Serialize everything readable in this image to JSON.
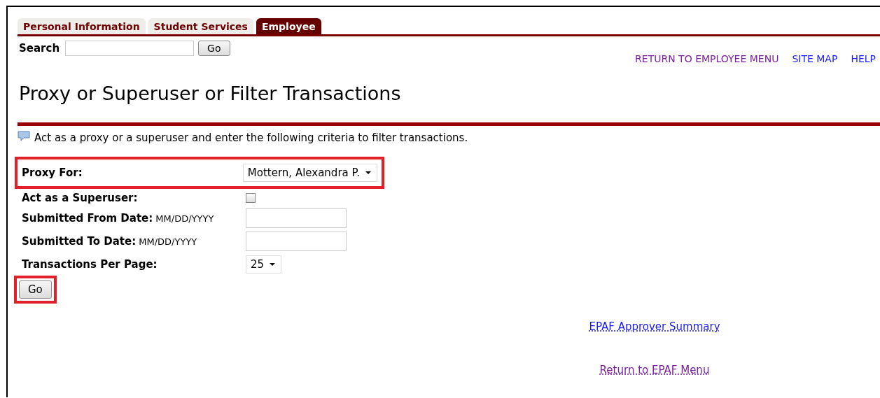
{
  "tabs": [
    {
      "label": "Personal Information",
      "selected": false
    },
    {
      "label": "Student Services",
      "selected": false
    },
    {
      "label": "Employee",
      "selected": true
    }
  ],
  "search": {
    "label": "Search",
    "button": "Go"
  },
  "top_links": [
    {
      "label": "RETURN TO EMPLOYEE MENU",
      "visited": true
    },
    {
      "label": "SITE MAP",
      "visited": false
    },
    {
      "label": "HELP",
      "visited": false
    }
  ],
  "page_title": "Proxy or Superuser or Filter Transactions",
  "info_text": "Act as a proxy or a superuser and enter the following criteria to filter transactions.",
  "form": [
    {
      "kind": "select",
      "label": "Proxy For:",
      "value": "Mottern, Alexandra P.",
      "highlighted": true
    },
    {
      "kind": "checkbox",
      "label": "Act as a Superuser:",
      "checked": false,
      "highlighted": false
    },
    {
      "kind": "date",
      "label": "Submitted From Date:",
      "hint": "MM/DD/YYYY",
      "highlighted": false
    },
    {
      "kind": "date",
      "label": "Submitted To Date:",
      "hint": "MM/DD/YYYY",
      "highlighted": false
    },
    {
      "kind": "select",
      "label": "Transactions Per Page:",
      "value": "25",
      "highlighted": false
    }
  ],
  "submit": {
    "label": "Go",
    "highlighted": true
  },
  "bottom_links": [
    {
      "label": "EPAF Approver Summary",
      "visited": false
    },
    {
      "label": "Return to EPAF Menu",
      "visited": true
    }
  ]
}
